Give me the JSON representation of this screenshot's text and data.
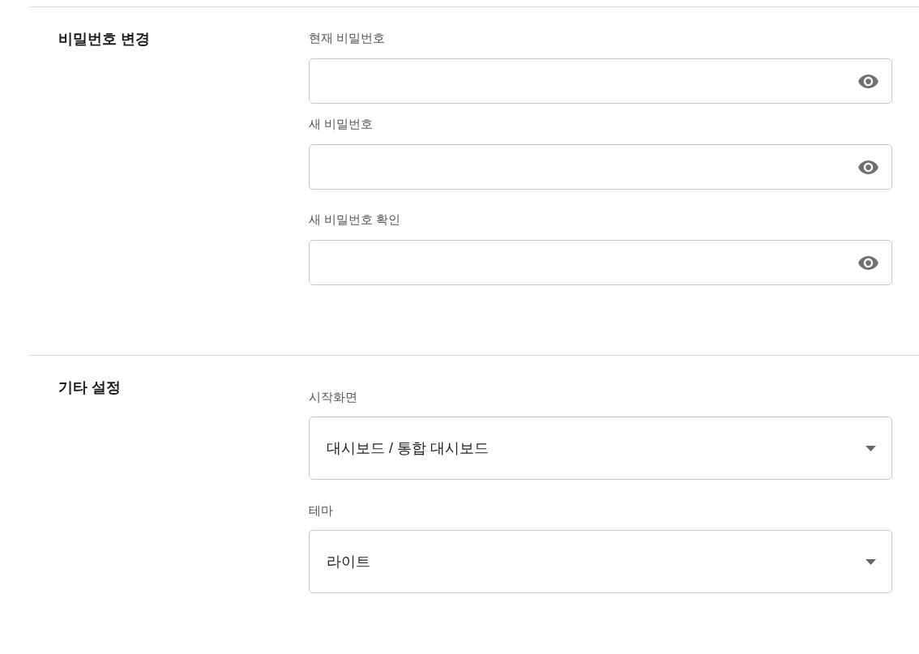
{
  "sections": [
    {
      "title": "비밀번호 변경",
      "fields": [
        {
          "kind": "password",
          "label": "현재 비밀번호"
        },
        {
          "kind": "password",
          "label": "새 비밀번호"
        },
        {
          "kind": "password",
          "label": "새 비밀번호 확인"
        }
      ]
    },
    {
      "title": "기타 설정",
      "fields": [
        {
          "kind": "select",
          "label": "시작화면",
          "value": "대시보드 / 통합 대시보드"
        },
        {
          "kind": "select",
          "label": "테마",
          "value": "라이트"
        }
      ]
    }
  ]
}
